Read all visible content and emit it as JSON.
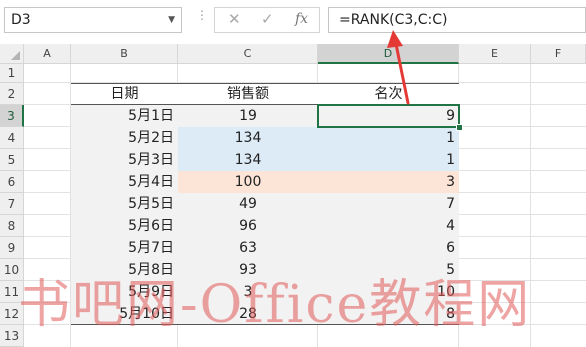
{
  "name_box": {
    "value": "D3"
  },
  "formula_bar": {
    "close_icon": "✕",
    "check_icon": "✓",
    "fx_label": "fx",
    "value": "=RANK(C3,C:C)"
  },
  "columns": [
    "A",
    "B",
    "C",
    "D",
    "E",
    "F"
  ],
  "rows": [
    "1",
    "2",
    "3",
    "4",
    "5",
    "6",
    "7",
    "8",
    "9",
    "10",
    "11",
    "12",
    "13"
  ],
  "table": {
    "headers": [
      "日期",
      "销售额",
      "名次"
    ],
    "rows": [
      {
        "date": "5月1日",
        "sales": "19",
        "rank": "9"
      },
      {
        "date": "5月2日",
        "sales": "134",
        "rank": "1"
      },
      {
        "date": "5月3日",
        "sales": "134",
        "rank": "1"
      },
      {
        "date": "5月4日",
        "sales": "100",
        "rank": "3"
      },
      {
        "date": "5月5日",
        "sales": "49",
        "rank": "7"
      },
      {
        "date": "5月6日",
        "sales": "96",
        "rank": "4"
      },
      {
        "date": "5月7日",
        "sales": "63",
        "rank": "6"
      },
      {
        "date": "5月8日",
        "sales": "93",
        "rank": "5"
      },
      {
        "date": "5月9日",
        "sales": "3",
        "rank": "10"
      },
      {
        "date": "5月10日",
        "sales": "28",
        "rank": "8"
      }
    ]
  },
  "selected_cell": "D3",
  "watermark": "书吧网-Office教程网",
  "colors": {
    "accent": "#217346",
    "row_band": "#f2f2f2",
    "highlight_blue": "#ddebf7",
    "highlight_orange": "#fce4d6",
    "arrow": "#e53935"
  }
}
